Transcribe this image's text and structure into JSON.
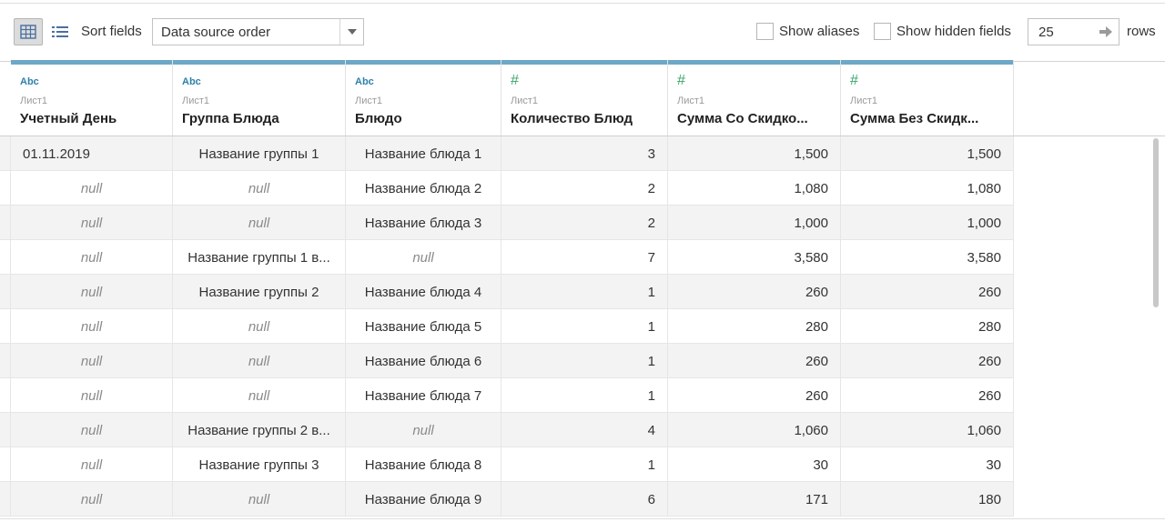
{
  "toolbar": {
    "sort_label": "Sort fields",
    "sort_value": "Data source order",
    "show_aliases": "Show aliases",
    "show_hidden": "Show hidden fields",
    "rows_value": "25",
    "rows_label": "rows"
  },
  "columns": [
    {
      "type": "Abc",
      "source": "Лист1",
      "name": "Учетный День"
    },
    {
      "type": "Abc",
      "source": "Лист1",
      "name": "Группа Блюда"
    },
    {
      "type": "Abc",
      "source": "Лист1",
      "name": "Блюдо"
    },
    {
      "type": "#",
      "source": "Лист1",
      "name": "Количество Блюд"
    },
    {
      "type": "#",
      "source": "Лист1",
      "name": "Сумма Со Скидко..."
    },
    {
      "type": "#",
      "source": "Лист1",
      "name": "Сумма Без Скидк..."
    }
  ],
  "rows": [
    [
      "01.11.2019",
      "Название группы 1",
      "Название блюда 1",
      "3",
      "1,500",
      "1,500"
    ],
    [
      "null",
      "null",
      "Название блюда 2",
      "2",
      "1,080",
      "1,080"
    ],
    [
      "null",
      "null",
      "Название блюда 3",
      "2",
      "1,000",
      "1,000"
    ],
    [
      "null",
      "Название группы 1 в...",
      "null",
      "7",
      "3,580",
      "3,580"
    ],
    [
      "null",
      "Название группы 2",
      "Название блюда 4",
      "1",
      "260",
      "260"
    ],
    [
      "null",
      "null",
      "Название блюда 5",
      "1",
      "280",
      "280"
    ],
    [
      "null",
      "null",
      "Название блюда 6",
      "1",
      "260",
      "260"
    ],
    [
      "null",
      "null",
      "Название блюда 7",
      "1",
      "260",
      "260"
    ],
    [
      "null",
      "Название группы 2 в...",
      "null",
      "4",
      "1,060",
      "1,060"
    ],
    [
      "null",
      "Название группы 3",
      "Название блюда 8",
      "1",
      "30",
      "30"
    ],
    [
      "null",
      "null",
      "Название блюда 9",
      "6",
      "171",
      "180"
    ]
  ],
  "icons": {
    "grid_view": "grid-view-icon",
    "list_view": "list-view-icon",
    "dropdown": "chevron-down-icon",
    "go": "arrow-right-icon"
  },
  "colors": {
    "header_bar": "#6fa7c6",
    "string_type": "#2d7fab",
    "number_type": "#3aa66a"
  }
}
